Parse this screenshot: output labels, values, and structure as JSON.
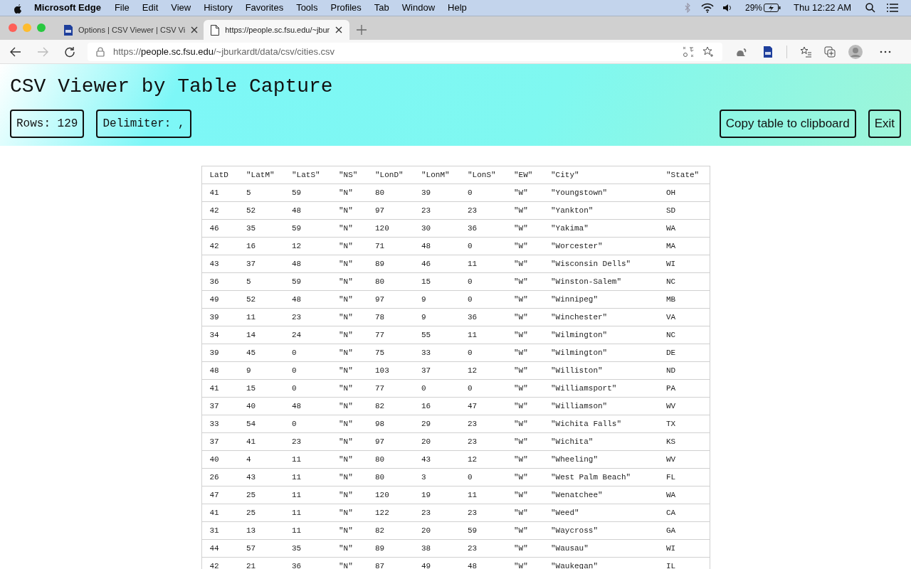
{
  "menu_bar": {
    "app": "Microsoft Edge",
    "items": [
      "File",
      "Edit",
      "View",
      "History",
      "Favorites",
      "Tools",
      "Profiles",
      "Tab",
      "Window",
      "Help"
    ],
    "battery": "29%",
    "clock": "Thu 12:22 AM"
  },
  "tabs": [
    {
      "label": "Options | CSV Viewer | CSV Vi",
      "selected": false,
      "kind": "csv"
    },
    {
      "label": "https://people.sc.fsu.edu/~jbur",
      "selected": true,
      "kind": "page"
    }
  ],
  "address": {
    "prefix": "https://",
    "host": "people.sc.fsu.edu",
    "path": "/~jburkardt/data/csv/cities.csv"
  },
  "page": {
    "title": "CSV Viewer by Table Capture",
    "rows": "Rows: 129",
    "delimiter": "Delimiter: ,",
    "buttons": [
      "Copy table to clipboard",
      "Exit"
    ]
  },
  "table": {
    "columns": [
      "LatD",
      "\"LatM\"",
      "\"LatS\"",
      "\"NS\"",
      "\"LonD\"",
      "\"LonM\"",
      "\"LonS\"",
      "\"EW\"",
      "\"City\"",
      "\"State\""
    ],
    "rows": [
      [
        "41",
        "5",
        "59",
        "\"N\"",
        "80",
        "39",
        "0",
        "\"W\"",
        "\"Youngstown\"",
        "OH"
      ],
      [
        "42",
        "52",
        "48",
        "\"N\"",
        "97",
        "23",
        "23",
        "\"W\"",
        "\"Yankton\"",
        "SD"
      ],
      [
        "46",
        "35",
        "59",
        "\"N\"",
        "120",
        "30",
        "36",
        "\"W\"",
        "\"Yakima\"",
        "WA"
      ],
      [
        "42",
        "16",
        "12",
        "\"N\"",
        "71",
        "48",
        "0",
        "\"W\"",
        "\"Worcester\"",
        "MA"
      ],
      [
        "43",
        "37",
        "48",
        "\"N\"",
        "89",
        "46",
        "11",
        "\"W\"",
        "\"Wisconsin Dells\"",
        "WI"
      ],
      [
        "36",
        "5",
        "59",
        "\"N\"",
        "80",
        "15",
        "0",
        "\"W\"",
        "\"Winston-Salem\"",
        "NC"
      ],
      [
        "49",
        "52",
        "48",
        "\"N\"",
        "97",
        "9",
        "0",
        "\"W\"",
        "\"Winnipeg\"",
        "MB"
      ],
      [
        "39",
        "11",
        "23",
        "\"N\"",
        "78",
        "9",
        "36",
        "\"W\"",
        "\"Winchester\"",
        "VA"
      ],
      [
        "34",
        "14",
        "24",
        "\"N\"",
        "77",
        "55",
        "11",
        "\"W\"",
        "\"Wilmington\"",
        "NC"
      ],
      [
        "39",
        "45",
        "0",
        "\"N\"",
        "75",
        "33",
        "0",
        "\"W\"",
        "\"Wilmington\"",
        "DE"
      ],
      [
        "48",
        "9",
        "0",
        "\"N\"",
        "103",
        "37",
        "12",
        "\"W\"",
        "\"Williston\"",
        "ND"
      ],
      [
        "41",
        "15",
        "0",
        "\"N\"",
        "77",
        "0",
        "0",
        "\"W\"",
        "\"Williamsport\"",
        "PA"
      ],
      [
        "37",
        "40",
        "48",
        "\"N\"",
        "82",
        "16",
        "47",
        "\"W\"",
        "\"Williamson\"",
        "WV"
      ],
      [
        "33",
        "54",
        "0",
        "\"N\"",
        "98",
        "29",
        "23",
        "\"W\"",
        "\"Wichita Falls\"",
        "TX"
      ],
      [
        "37",
        "41",
        "23",
        "\"N\"",
        "97",
        "20",
        "23",
        "\"W\"",
        "\"Wichita\"",
        "KS"
      ],
      [
        "40",
        "4",
        "11",
        "\"N\"",
        "80",
        "43",
        "12",
        "\"W\"",
        "\"Wheeling\"",
        "WV"
      ],
      [
        "26",
        "43",
        "11",
        "\"N\"",
        "80",
        "3",
        "0",
        "\"W\"",
        "\"West Palm Beach\"",
        "FL"
      ],
      [
        "47",
        "25",
        "11",
        "\"N\"",
        "120",
        "19",
        "11",
        "\"W\"",
        "\"Wenatchee\"",
        "WA"
      ],
      [
        "41",
        "25",
        "11",
        "\"N\"",
        "122",
        "23",
        "23",
        "\"W\"",
        "\"Weed\"",
        "CA"
      ],
      [
        "31",
        "13",
        "11",
        "\"N\"",
        "82",
        "20",
        "59",
        "\"W\"",
        "\"Waycross\"",
        "GA"
      ],
      [
        "44",
        "57",
        "35",
        "\"N\"",
        "89",
        "38",
        "23",
        "\"W\"",
        "\"Wausau\"",
        "WI"
      ],
      [
        "42",
        "21",
        "36",
        "\"N\"",
        "87",
        "49",
        "48",
        "\"W\"",
        "\"Waukegan\"",
        "IL"
      ]
    ]
  }
}
